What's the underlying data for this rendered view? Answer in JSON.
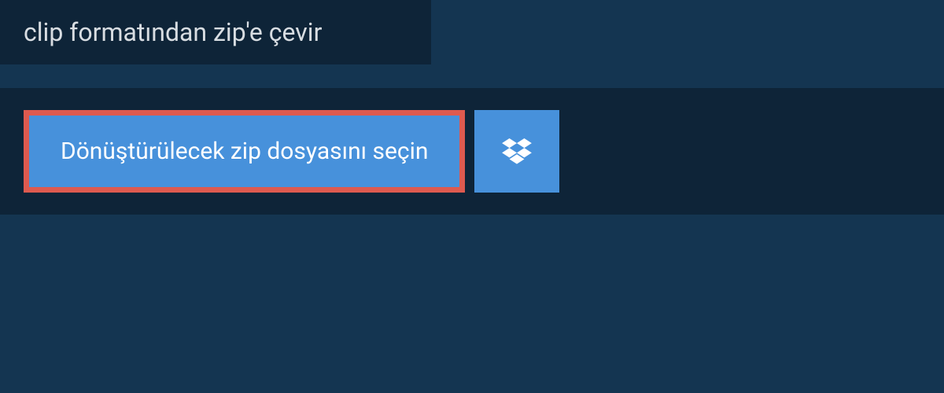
{
  "header": {
    "title": "clip formatından zip'e çevir"
  },
  "main": {
    "file_select_label": "Dönüştürülecek zip dosyasını seçin"
  }
}
